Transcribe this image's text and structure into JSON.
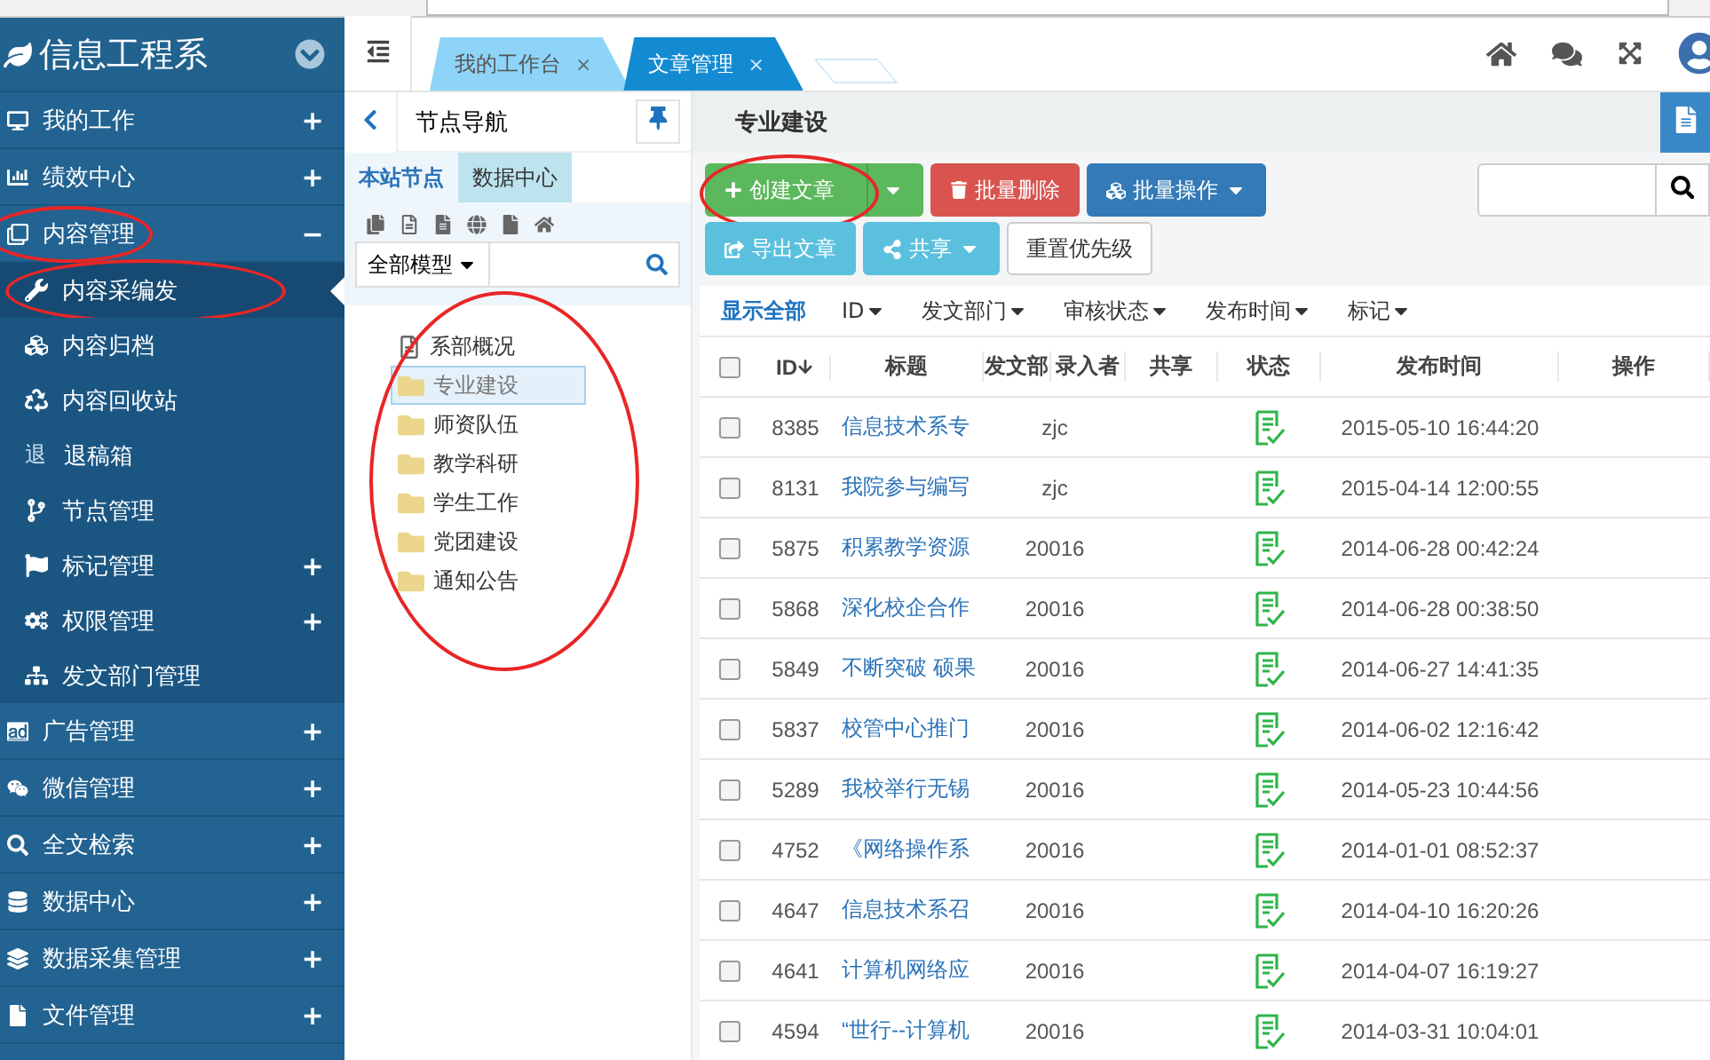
{
  "sidebar": {
    "title": "信息工程系",
    "items": [
      {
        "label": "我的工作",
        "toggle": "+",
        "selected": false,
        "circled": false
      },
      {
        "label": "绩效中心",
        "toggle": "+",
        "selected": false,
        "circled": false
      },
      {
        "label": "内容管理",
        "toggle": "−",
        "expanded": true,
        "selected": false,
        "circled": true,
        "children": [
          {
            "label": "内容采编发",
            "selected": true,
            "circled": true
          },
          {
            "label": "内容归档",
            "selected": false,
            "circled": false
          },
          {
            "label": "内容回收站",
            "selected": false,
            "circled": false
          },
          {
            "label": "退稿箱",
            "glyph": "退",
            "selected": false,
            "circled": false
          },
          {
            "label": "节点管理",
            "selected": false,
            "circled": false
          },
          {
            "label": "标记管理",
            "toggle": "+",
            "selected": false,
            "circled": false
          },
          {
            "label": "权限管理",
            "toggle": "+",
            "selected": false,
            "circled": false
          },
          {
            "label": "发文部门管理",
            "selected": false,
            "circled": false
          }
        ]
      },
      {
        "label": "广告管理",
        "toggle": "+",
        "selected": false,
        "circled": false
      },
      {
        "label": "微信管理",
        "toggle": "+",
        "selected": false,
        "circled": false
      },
      {
        "label": "全文检索",
        "toggle": "+",
        "selected": false,
        "circled": false
      },
      {
        "label": "数据中心",
        "toggle": "+",
        "selected": false,
        "circled": false
      },
      {
        "label": "数据采集管理",
        "toggle": "+",
        "selected": false,
        "circled": false
      },
      {
        "label": "文件管理",
        "toggle": "+",
        "selected": false,
        "circled": false
      }
    ]
  },
  "tabs": [
    {
      "label": "我的工作台",
      "close": "×",
      "selected": false
    },
    {
      "label": "文章管理",
      "close": "×",
      "selected": true
    }
  ],
  "node_nav": {
    "title": "节点导航",
    "tabs": [
      {
        "label": "本站节点",
        "selected": true
      },
      {
        "label": "数据中心",
        "selected": false
      }
    ],
    "model_select": "全部模型",
    "circled": true,
    "tree": [
      {
        "label": "系部概况",
        "kind": "page",
        "selected": false
      },
      {
        "label": "专业建设",
        "kind": "folder",
        "selected": true
      },
      {
        "label": "师资队伍",
        "kind": "folder",
        "selected": false
      },
      {
        "label": "教学科研",
        "kind": "folder",
        "selected": false
      },
      {
        "label": "学生工作",
        "kind": "folder",
        "selected": false
      },
      {
        "label": "党团建设",
        "kind": "folder",
        "selected": false
      },
      {
        "label": "通知公告",
        "kind": "folder",
        "selected": false
      }
    ]
  },
  "content": {
    "title": "专业建设",
    "buttons": [
      {
        "label": "创建文章",
        "kind": "success",
        "split": true,
        "circled": true
      },
      {
        "label": "批量删除",
        "kind": "danger",
        "split": false,
        "circled": false
      },
      {
        "label": "批量操作",
        "kind": "primary",
        "caret": true,
        "circled": false
      },
      {
        "label": "导出文章",
        "kind": "info",
        "circled": false
      },
      {
        "label": "共享",
        "kind": "info",
        "caret": true,
        "circled": false
      },
      {
        "label": "重置优先级",
        "kind": "default",
        "circled": false
      }
    ],
    "filters": [
      {
        "label": "显示全部",
        "kind": "link"
      },
      {
        "label": "ID",
        "kind": "drop"
      },
      {
        "label": "发文部门",
        "kind": "drop"
      },
      {
        "label": "审核状态",
        "kind": "drop"
      },
      {
        "label": "发布时间",
        "kind": "drop"
      },
      {
        "label": "标记",
        "kind": "drop"
      }
    ],
    "columns": [
      "ID",
      "标题",
      "发文部",
      "录入者",
      "共享",
      "状态",
      "发布时间",
      "操作"
    ],
    "header_checked": false,
    "rows": [
      {
        "id": "8385",
        "title": "信息技术系专",
        "author": "zjc",
        "approved": true,
        "time": "2015-05-10 16:44:20",
        "checked": false
      },
      {
        "id": "8131",
        "title": "我院参与编写",
        "author": "zjc",
        "approved": true,
        "time": "2015-04-14 12:00:55",
        "checked": false
      },
      {
        "id": "5875",
        "title": "积累教学资源",
        "author": "20016",
        "approved": true,
        "time": "2014-06-28 00:42:24",
        "checked": false
      },
      {
        "id": "5868",
        "title": "深化校企合作",
        "author": "20016",
        "approved": true,
        "time": "2014-06-28 00:38:50",
        "checked": false
      },
      {
        "id": "5849",
        "title": "不断突破 硕果",
        "author": "20016",
        "approved": true,
        "time": "2014-06-27 14:41:35",
        "checked": false
      },
      {
        "id": "5837",
        "title": "校管中心推门",
        "author": "20016",
        "approved": true,
        "time": "2014-06-02 12:16:42",
        "checked": false
      },
      {
        "id": "5289",
        "title": "我校举行无锡",
        "author": "20016",
        "approved": true,
        "time": "2014-05-23 10:44:56",
        "checked": false
      },
      {
        "id": "4752",
        "title": "《网络操作系",
        "author": "20016",
        "approved": true,
        "time": "2014-01-01 08:52:37",
        "checked": false
      },
      {
        "id": "4647",
        "title": "信息技术系召",
        "author": "20016",
        "approved": true,
        "time": "2014-04-10 16:20:26",
        "checked": false
      },
      {
        "id": "4641",
        "title": "计算机网络应",
        "author": "20016",
        "approved": true,
        "time": "2014-04-07 16:19:27",
        "checked": false
      },
      {
        "id": "4594",
        "title": "“世行--计算机",
        "author": "20016",
        "approved": true,
        "time": "2014-03-31 10:04:01",
        "checked": false
      }
    ]
  }
}
